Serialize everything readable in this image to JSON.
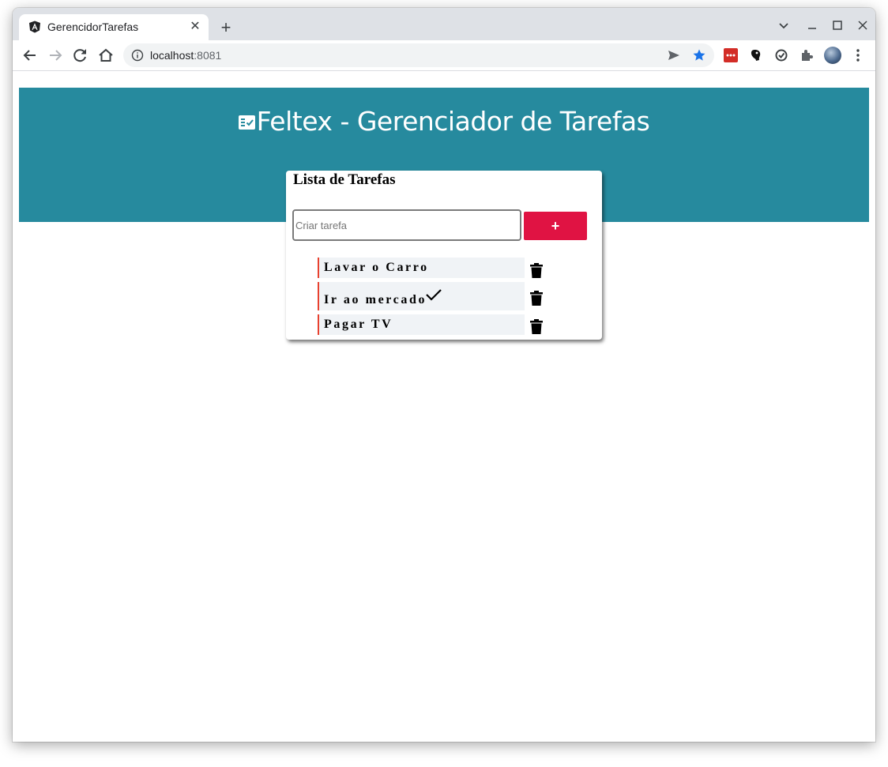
{
  "browser": {
    "tab_title": "GerencidorTarefas",
    "url_host": "localhost",
    "url_port": ":8081"
  },
  "app": {
    "header_title": "Feltex - Gerenciador de Tarefas",
    "header_color": "#268a9e",
    "list_title": "Lista de Tarefas",
    "input_placeholder": "Criar tarefa",
    "input_value": "",
    "add_button_label": "+",
    "accent_color": "#e01343"
  },
  "tasks": [
    {
      "label": "Lavar o Carro",
      "completed": false
    },
    {
      "label": "Ir ao mercado",
      "completed": true
    },
    {
      "label": "Pagar TV",
      "completed": false
    }
  ]
}
